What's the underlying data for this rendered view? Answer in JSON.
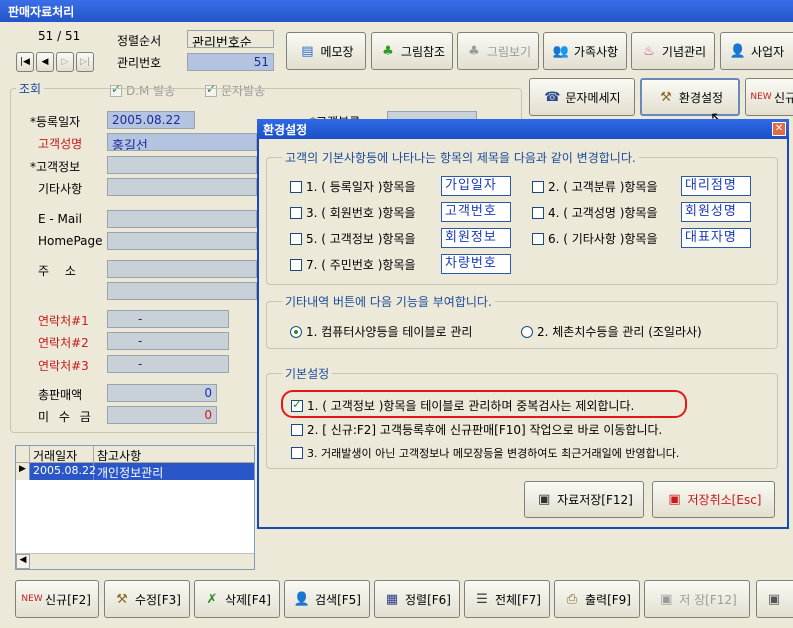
{
  "window": {
    "title": "판매자료처리"
  },
  "nav": {
    "page_counter": "51 / 51"
  },
  "sort": {
    "label": "정렬순서",
    "value": "관리번호순"
  },
  "mgmt": {
    "label": "관리번호",
    "value": "51"
  },
  "toolbar_top": {
    "memo": "메모장",
    "picture_ref": "그림참조",
    "picture_view": "그림보기",
    "family": "가족사항",
    "anniversary": "기념관리",
    "business": "사업자"
  },
  "toolbar_mid": {
    "sms": "문자메세지",
    "env": "환경설정",
    "new_partial": "신규"
  },
  "checks_top": {
    "dm": "D.M 발송",
    "sms_send": "문자발송"
  },
  "search_group": "조회",
  "form": {
    "reg_date_label": "*등록일자",
    "reg_date_value": "2005.08.22",
    "cust_name_label": "고객성명",
    "cust_name_value": "홍길선",
    "cust_info_label": "*고객정보",
    "etc_label": "기타사항",
    "email_label": "E - Mail",
    "homepage_label": "HomePage",
    "address_label": "주 소",
    "contact1_label": "연락처#1",
    "contact1_value": "-",
    "contact2_label": "연락처#2",
    "contact2_value": "-",
    "contact3_label": "연락처#3",
    "contact3_value": "-",
    "total_sales_label": "총판매액",
    "total_sales_value": "0",
    "unpaid_label": "미 수 금",
    "unpaid_value": "0",
    "category_label_partial": "*고객분류"
  },
  "grid": {
    "columns": [
      "거래일자",
      "참고사항"
    ],
    "rows": [
      {
        "date": "2005.08.22",
        "note": "개인정보관리"
      }
    ]
  },
  "toolbar_bottom": {
    "new": "신규[F2]",
    "edit": "수정[F3]",
    "delete": "삭제[F4]",
    "search": "검색[F5]",
    "sort": "정렬[F6]",
    "all": "전체[F7]",
    "print": "출력[F9]",
    "save": "저 장[F12]"
  },
  "dialog": {
    "title": "환경설정",
    "section1_title": "고객의 기본사항등에 나타나는 항목의 제목을 다음과 같이 변경합니다.",
    "items": [
      {
        "label": "1. ( 등록일자 )항목을",
        "value": "가입일자",
        "checked": false
      },
      {
        "label": "2. ( 고객분류 )항목을",
        "value": "대리점명",
        "checked": false
      },
      {
        "label": "3. ( 회원번호 )항목을",
        "value": "고객번호",
        "checked": false
      },
      {
        "label": "4. ( 고객성명 )항목을",
        "value": "회원성명",
        "checked": false
      },
      {
        "label": "5. ( 고객정보 )항목을",
        "value": "회원정보",
        "checked": false
      },
      {
        "label": "6. ( 기타사항 )항목을",
        "value": "대표자명",
        "checked": false
      },
      {
        "label": "7. ( 주민번호 )항목을",
        "value": "차량번호",
        "checked": false
      }
    ],
    "section2_title": "기타내역 버튼에 다음 기능을 부여합니다.",
    "radio1": "1. 컴퓨터사양등을 테이블로 관리",
    "radio2": "2. 체촌치수등을 관리 (조일라사)",
    "section3_title": "기본설정",
    "basic1": "1. ( 고객정보 )항목을 테이블로 관리하며 중복검사는 제외합니다.",
    "basic2": "2. [ 신규:F2] 고객등록후에 신규판매[F10] 작업으로 바로 이동합니다.",
    "basic3": "3. 거래발생이 아닌 고객정보나 메모장등을 변경하여도 최근거래일에 반영합니다.",
    "save_btn": "자료저장[F12]",
    "cancel_btn": "저장취소[Esc]",
    "highlight_color": "#e01818"
  }
}
